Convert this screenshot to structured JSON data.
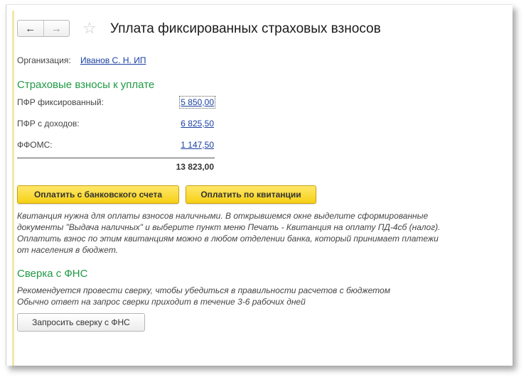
{
  "window": {
    "title": "Уплата фиксированных страховых взносов",
    "nav": {
      "back_icon": "←",
      "forward_icon": "→"
    },
    "favorite_icon": "☆"
  },
  "organization": {
    "label": "Организация:",
    "value": "Иванов С. Н. ИП"
  },
  "contributions": {
    "heading": "Страховые взносы к уплате",
    "rows": [
      {
        "label": "ПФР фиксированный:",
        "value": "5 850,00"
      },
      {
        "label": "ПФР с доходов:",
        "value": "6 825,50"
      },
      {
        "label": "ФФОМС:",
        "value": "1 147,50"
      }
    ],
    "total": "13 823,00"
  },
  "actions": {
    "pay_bank": "Оплатить с банковского счета",
    "pay_receipt": "Оплатить по квитанции"
  },
  "receipt_note": [
    "Квитанция нужна для оплаты взносов наличными. В открывшемся окне выделите сформированные",
    "документы \"Выдача наличных\" и выберите пункт меню Печать - Квитанция на оплату ПД-4сб (налог).",
    "Оплатить взнос по этим квитанциям можно в любом отделении банка, который принимает платежи",
    "от населения в бюджет."
  ],
  "fns": {
    "heading": "Сверка с ФНС",
    "notes": [
      "Рекомендуется провести сверку, чтобы убедиться в правильности расчетов с бюджетом",
      "Обычно ответ на запрос сверки приходит в течение 3-6 рабочих дней"
    ],
    "request_button": "Запросить сверку с ФНС"
  },
  "colors": {
    "section_heading": "#1f9a45",
    "link": "#1a3fa0",
    "primary_button": "#f6cf15"
  }
}
